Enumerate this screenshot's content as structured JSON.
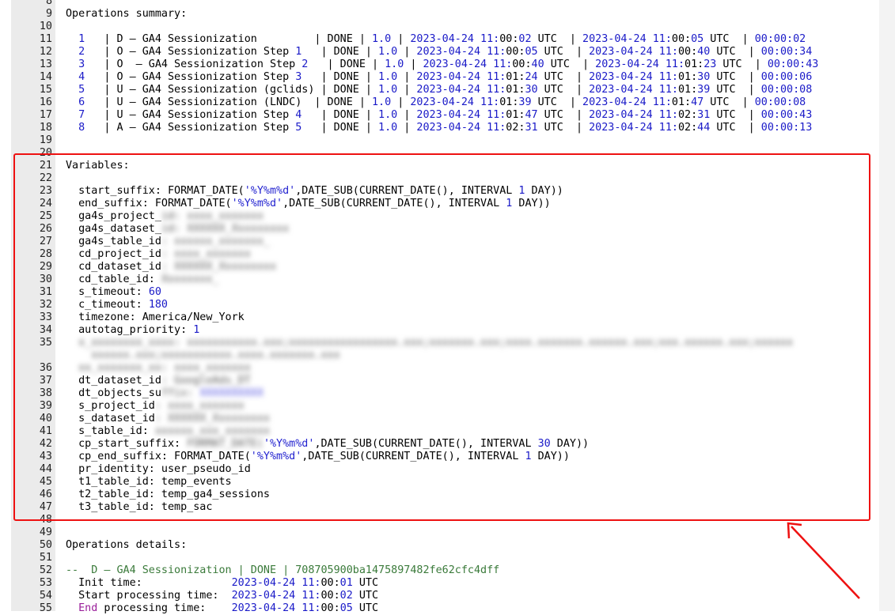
{
  "summary": {
    "lines": [
      {
        "n": "8",
        "text": ""
      },
      {
        "n": "9",
        "text": "Operations summary:"
      },
      {
        "n": "10",
        "text": ""
      },
      {
        "n": "11",
        "idx": "1",
        "name": "D – GA4 Sessionization        ",
        "status": "DONE",
        "ver": "1.0",
        "start": "2023-04-24 11:00:02",
        "end": "2023-04-24 11:00:05",
        "dur": "00:00:02"
      },
      {
        "n": "12",
        "idx": "2",
        "name": "O – GA4 Sessionization Step ",
        "step": "1",
        "status": "DONE",
        "ver": "1.0",
        "start": "2023-04-24 11:00:05",
        "end": "2023-04-24 11:00:40",
        "dur": "00:00:34"
      },
      {
        "n": "13",
        "idx": "3",
        "name": "O  – GA4 Sessionization Step ",
        "step": "2",
        "status": "DONE",
        "ver": "1.0",
        "start": "2023-04-24 11:00:40",
        "end": "2023-04-24 11:01:23",
        "dur": "00:00:43"
      },
      {
        "n": "14",
        "idx": "4",
        "name": "O – GA4 Sessionization Step ",
        "step": "3",
        "status": "DONE",
        "ver": "1.0",
        "start": "2023-04-24 11:01:24",
        "end": "2023-04-24 11:01:30",
        "dur": "00:00:06"
      },
      {
        "n": "15",
        "idx": "5",
        "name": "U – GA4 Sessionization (gclids)",
        "status": "DONE",
        "ver": "1.0",
        "start": "2023-04-24 11:01:30",
        "end": "2023-04-24 11:01:39",
        "dur": "00:00:08"
      },
      {
        "n": "16",
        "idx": "6",
        "name": "U – GA4 Sessionization (LNDC) ",
        "status": "DONE",
        "ver": "1.0",
        "start": "2023-04-24 11:01:39",
        "end": "2023-04-24 11:01:47",
        "dur": "00:00:08"
      },
      {
        "n": "17",
        "idx": "7",
        "name": "U – GA4 Sessionization Step ",
        "step": "4",
        "status": "DONE",
        "ver": "1.0",
        "start": "2023-04-24 11:01:47",
        "end": "2023-04-24 11:02:31",
        "dur": "00:00:43"
      },
      {
        "n": "18",
        "idx": "8",
        "name": "A – GA4 Sessionization Step ",
        "step": "5",
        "status": "DONE",
        "ver": "1.0",
        "start": "2023-04-24 11:02:31",
        "end": "2023-04-24 11:02:44",
        "dur": "00:00:13"
      },
      {
        "n": "19",
        "text": ""
      },
      {
        "n": "20",
        "text": ""
      }
    ],
    "utc": "UTC"
  },
  "vars": {
    "l21": {
      "n": "21",
      "text": "Variables:"
    },
    "l22": {
      "n": "22"
    },
    "l23": {
      "n": "23",
      "a": "  start_suffix: FORMAT_DATE(",
      "s": "'%Y%m%d'",
      "b": ",DATE_SUB(CURRENT_DATE(), INTERVAL ",
      "num": "1",
      "c": " DAY))"
    },
    "l24": {
      "n": "24",
      "a": "  end_suffix: FORMAT_DATE(",
      "s": "'%Y%m%d'",
      "b": ",DATE_SUB(CURRENT_DATE(), INTERVAL ",
      "num": "1",
      "c": " DAY))"
    },
    "l25": {
      "n": "25",
      "a": "  ga4s_project_",
      "blur": "id: xxxx_xxxxxxx"
    },
    "l26": {
      "n": "26",
      "a": "  ga4s_dataset_",
      "blur": "id: XXXXXX_Xxxxxxxxx"
    },
    "l27": {
      "n": "27",
      "a": "  ga4s_table_id",
      "blur": ": xxxxxx_xxxxxxx_"
    },
    "l28": {
      "n": "28",
      "a": "  cd_project_id",
      "blur": ": xxxx_xxxxxxx"
    },
    "l29": {
      "n": "29",
      "a": "  cd_dataset_id",
      "blur": ": XXXXXX_Xxxxxxxxx"
    },
    "l30": {
      "n": "30",
      "a": "  cd_table_id: ",
      "blur": "Xxxxxxxx_"
    },
    "l31": {
      "n": "31",
      "a": "  s_timeout: ",
      "num": "60"
    },
    "l32": {
      "n": "32",
      "a": "  c_timeout: ",
      "num": "180"
    },
    "l33": {
      "n": "33",
      "a": "  timezone: America/New_York"
    },
    "l34": {
      "n": "34",
      "a": "  autotag_priority: ",
      "num": "1"
    },
    "l35": {
      "n": "35",
      "blur": "  x_xxxxxxxx_xxxx: xxxxxxxxxxx.xxx;xxxxxxxxxxxxxxxxx.xxx;xxxxxxx.xxx;xxxx.xxxxxxx.xxxxxx.xxx;xxx.xxxxxx.xxx;xxxxxx"
    },
    "l35b": {
      "blur": "    xxxxxx.xxx;xxxxxxxxxxx.xxxx.xxxxxxx.xxx"
    },
    "l36": {
      "n": "36",
      "blur": "  xx_xxxxxxx_xx: xxxx_xxxxxxx"
    },
    "l37": {
      "n": "37",
      "a": "  dt_dataset_id",
      "blur": ": GoogleAds_DT"
    },
    "l38": {
      "n": "38",
      "a": "  dt_objects_su",
      "blur": "ffix: ",
      "blurb": "XXXXXXXXXX"
    },
    "l39": {
      "n": "39",
      "a": "  s_project_id",
      "blur": ": xxxx_xxxxxxx"
    },
    "l40": {
      "n": "40",
      "a": "  s_dataset_id",
      "blur": ": XXXXXX_Xxxxxxxxx"
    },
    "l41": {
      "n": "41",
      "a": "  s_table_id: ",
      "blur": "xxxxxx_xxx_xxxxxxx"
    },
    "l42": {
      "n": "42",
      "a": "  cp_start_suffix: ",
      "blurtxt": "FORMAT_DATE(",
      "s": "'%Y%m%d'",
      "b": ",DATE_SUB(CURRENT_DATE(), INTERVAL ",
      "num": "30",
      "c": " DAY))"
    },
    "l43": {
      "n": "43",
      "a": "  cp_end_suffix: FORMAT_DATE(",
      "s": "'%Y%m%d'",
      "b": ",DATE_SUB(CURRENT_DATE(), INTERVAL ",
      "num": "1",
      "c": " DAY))"
    },
    "l44": {
      "n": "44",
      "a": "  pr_identity: user_pseudo_id"
    },
    "l45": {
      "n": "45",
      "a": "  t1_table_id: temp_events"
    },
    "l46": {
      "n": "46",
      "a": "  t2_table_id: temp_ga4_sessions"
    },
    "l47": {
      "n": "47",
      "a": "  t3_table_id: temp_sac"
    },
    "l48": {
      "n": "48"
    },
    "l49": {
      "n": "49"
    }
  },
  "details": {
    "l50": {
      "n": "50",
      "text": "Operations details:"
    },
    "l51": {
      "n": "51"
    },
    "l52": {
      "n": "52",
      "text": "--  D – GA4 Sessionization | DONE | 708705900ba1475897482fe62cfc4dff"
    },
    "l53": {
      "n": "53",
      "label": "  Init time:              ",
      "ts": "2023-04-24 11:00:01",
      "utc": " UTC"
    },
    "l54": {
      "n": "54",
      "label": "  Start processing time:  ",
      "ts": "2023-04-24 11:00:02",
      "utc": " UTC"
    },
    "l55": {
      "n": "55",
      "kw": "End",
      "label": " processing time:    ",
      "ts": "2023-04-24 11:00:05",
      "utc": " UTC"
    }
  },
  "colors": {
    "highlight_box": "#ee1111",
    "number": "#1a1ac8",
    "comment": "#3a7a3a",
    "keyword": "#9a1e9a"
  }
}
